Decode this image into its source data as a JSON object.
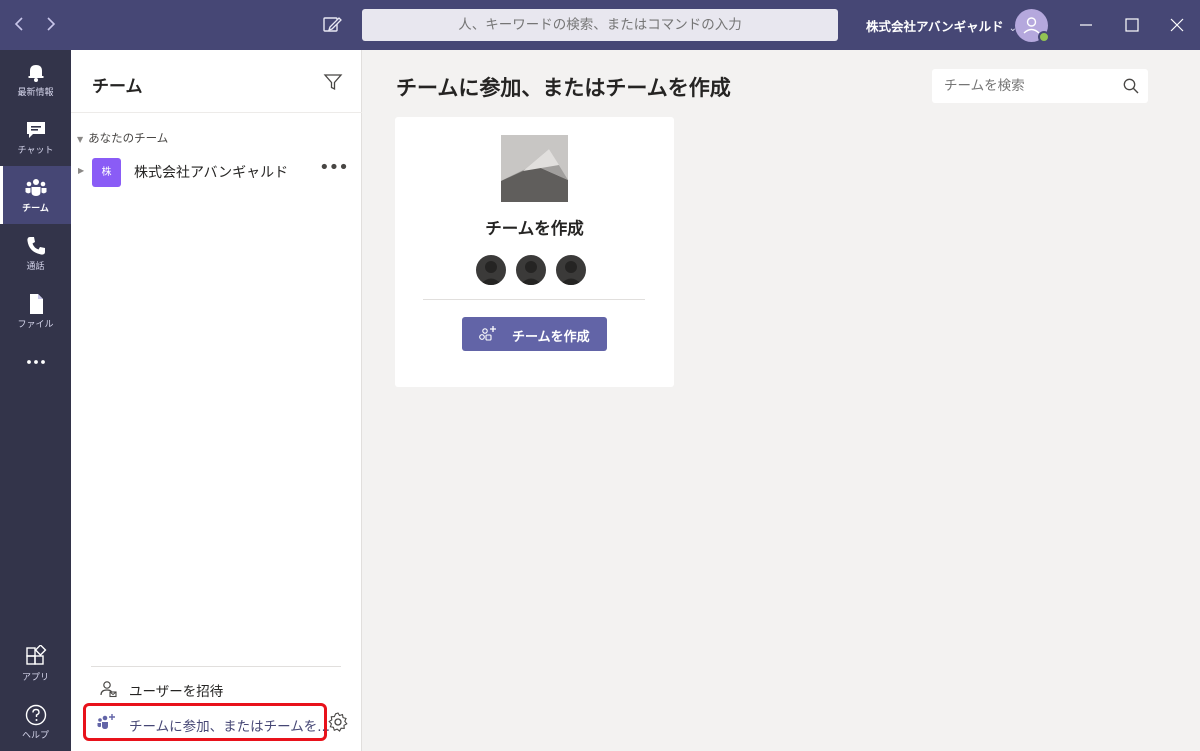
{
  "titlebar": {
    "search_placeholder": "人、キーワードの検索、またはコマンドの入力",
    "tenant_name": "株式会社アバンギャルド",
    "accent_color": "#464775",
    "presence_color": "#92c353"
  },
  "rail": {
    "items": [
      {
        "label": "最新情報",
        "icon": "bell-icon"
      },
      {
        "label": "チャット",
        "icon": "chat-icon"
      },
      {
        "label": "チーム",
        "icon": "teams-icon",
        "active": true
      },
      {
        "label": "通話",
        "icon": "phone-icon"
      },
      {
        "label": "ファイル",
        "icon": "file-icon"
      },
      {
        "label": "",
        "icon": "more-icon"
      }
    ],
    "bottom_items": [
      {
        "label": "アプリ",
        "icon": "apps-icon"
      },
      {
        "label": "ヘルプ",
        "icon": "help-icon"
      }
    ]
  },
  "panel": {
    "title": "チーム",
    "section_label": "あなたのチーム",
    "teams": [
      {
        "avatar_text": "株",
        "name": "株式会社アバンギャルド",
        "avatar_color": "#8a5cf6"
      }
    ],
    "invite_label": "ユーザーを招待",
    "join_label": "チームに参加、またはチームを..."
  },
  "main": {
    "title": "チームに参加、またはチームを作成",
    "search_placeholder": "チームを検索",
    "card": {
      "title": "チームを作成",
      "button_label": "チームを作成",
      "button_color": "#6264a7"
    }
  }
}
